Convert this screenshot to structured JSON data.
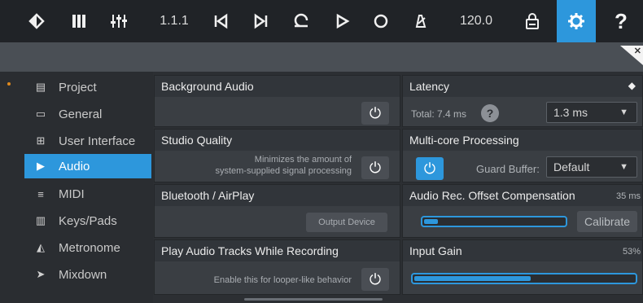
{
  "toolbar": {
    "position": "1.1.1",
    "tempo": "120.0",
    "icons": [
      "tag-icon",
      "keyboard-icon",
      "mixer-icon",
      "skip-back-icon",
      "skip-forward-icon",
      "loop-icon",
      "play-icon",
      "record-icon",
      "metronome-icon",
      "lock-icon",
      "gear-icon",
      "help-icon"
    ]
  },
  "sidebar": {
    "items": [
      {
        "label": "Project",
        "icon": "project-icon"
      },
      {
        "label": "General",
        "icon": "general-icon"
      },
      {
        "label": "User Interface",
        "icon": "user-interface-icon"
      },
      {
        "label": "Audio",
        "icon": "play-arrow-icon"
      },
      {
        "label": "MIDI",
        "icon": "midi-icon"
      },
      {
        "label": "Keys/Pads",
        "icon": "keys-icon"
      },
      {
        "label": "Metronome",
        "icon": "metronome-icon"
      },
      {
        "label": "Mixdown",
        "icon": "mixdown-icon"
      }
    ],
    "active": "Audio"
  },
  "panels": {
    "background_audio": {
      "title": "Background Audio"
    },
    "studio_quality": {
      "title": "Studio Quality",
      "desc_line1": "Minimizes the amount of",
      "desc_line2": "system-supplied signal processing"
    },
    "bluetooth": {
      "title": "Bluetooth / AirPlay",
      "button": "Output Device"
    },
    "play_tracks": {
      "title": "Play Audio Tracks While Recording",
      "desc": "Enable this for looper-like behavior"
    },
    "latency": {
      "title": "Latency",
      "total": "Total: 7.4 ms",
      "help": "?",
      "value": "1.3 ms"
    },
    "multicore": {
      "title": "Multi-core Processing",
      "guard_label": "Guard Buffer:",
      "guard_value": "Default"
    },
    "offset": {
      "title": "Audio Rec. Offset Compensation",
      "value": "35 ms",
      "button": "Calibrate",
      "level": 0.1
    },
    "input_gain": {
      "title": "Input Gain",
      "value": "53%",
      "level": 0.53
    }
  },
  "colors": {
    "accent": "#2d97dc",
    "toolbar": "#202327",
    "panel": "#3a3e43"
  }
}
